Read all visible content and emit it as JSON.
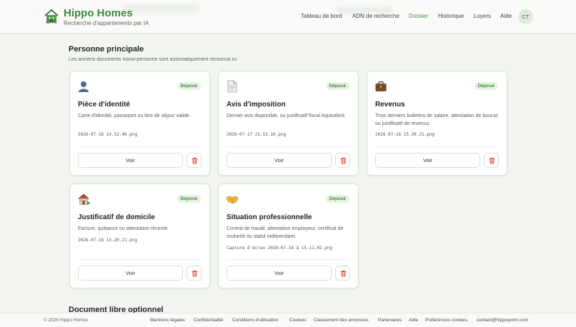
{
  "brand": {
    "name": "Hippo Homes",
    "subtitle": "Recherche d'appartements par IA",
    "logo_label": "HIPPO"
  },
  "nav": {
    "items": [
      "Tableau de bord",
      "ADN de recherche",
      "Dossier",
      "Historique",
      "Loyers",
      "Aide"
    ],
    "active": "Dossier",
    "avatar": "CT"
  },
  "section": {
    "title": "Personne principale",
    "description": "Les anciens documents mono-personne sont automatiquement reconnus ici."
  },
  "cards": [
    {
      "icon": "person-silhouette-icon",
      "badge": "Déposé",
      "title": "Pièce d'identité",
      "description": "Carte d'identité, passeport ou titre de séjour valide.",
      "file": "2026-07-16 14.52.46.png",
      "view_label": "Voir"
    },
    {
      "icon": "document-icon",
      "badge": "Déposé",
      "title": "Avis d'imposition",
      "description": "Dernier avis disponible, ou justificatif fiscal équivalent.",
      "file": "2026-07-17 21.53.10.png",
      "view_label": "Voir"
    },
    {
      "icon": "briefcase-icon",
      "badge": "Déposé",
      "title": "Revenus",
      "description": "Trois derniers bulletins de salaire, attestation de bourse ou justificatif de revenus.",
      "file": "2026-07-16 15.20.21.png",
      "view_label": "Voir"
    },
    {
      "icon": "house-icon",
      "badge": "Déposé",
      "title": "Justificatif de domicile",
      "description": "Facture, quittance ou attestation récente.",
      "file": "2026-07-16 15.20.21.png",
      "view_label": "Voir"
    },
    {
      "icon": "handshake-icon",
      "badge": "Déposé",
      "title": "Situation professionnelle",
      "description": "Contrat de travail, attestation employeur, certificat de scolarité ou statut indépendant.",
      "file": "Capture d'écran 2026-07-16 à 15.11.02.png",
      "view_label": "Voir"
    }
  ],
  "next_section": {
    "title": "Document libre optionnel"
  },
  "footer": {
    "copyright": "© 2026 Hippo Homes",
    "links": [
      "Mentions légales",
      "Confidentialité",
      "Conditions d'utilisation",
      "Cookies",
      "Classement des annonces",
      "Partenaires",
      "Aide",
      "Préférences cookies",
      "contact@hippopotm.com"
    ]
  },
  "colors": {
    "accent": "#3e8a3a",
    "badge_bg": "#e6f3e2",
    "card_border": "#d4e5d0",
    "delete": "#d9443c",
    "background": "#f3f5f1"
  }
}
